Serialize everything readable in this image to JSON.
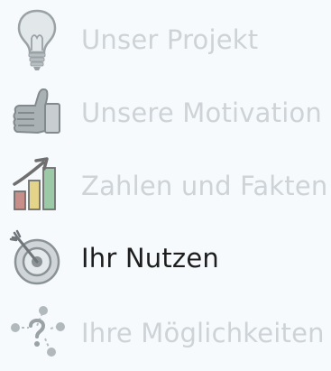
{
  "nav": {
    "items": [
      {
        "label": "Unser Projekt",
        "icon": "lightbulb-icon",
        "active": false
      },
      {
        "label": "Unsere Motivation",
        "icon": "thumbs-up-icon",
        "active": false
      },
      {
        "label": "Zahlen und Fakten",
        "icon": "bar-chart-icon",
        "active": false
      },
      {
        "label": "Ihr Nutzen",
        "icon": "target-icon",
        "active": true
      },
      {
        "label": "Ihre Möglichkeiten",
        "icon": "question-network-icon",
        "active": false
      }
    ]
  },
  "colors": {
    "inactive_text": "#cdd3d6",
    "active_text": "#1e1e1e",
    "background": "#f6fafc"
  }
}
